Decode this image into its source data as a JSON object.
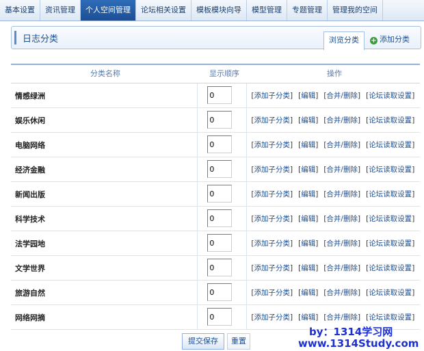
{
  "nav": {
    "tabs": [
      {
        "label": "基本设置"
      },
      {
        "label": "资讯管理"
      },
      {
        "label": "个人空间管理"
      },
      {
        "label": "论坛相关设置"
      },
      {
        "label": "模板模块向导"
      },
      {
        "label": "模型管理"
      },
      {
        "label": "专题管理"
      },
      {
        "label": "管理我的空间"
      }
    ],
    "active_index": 2
  },
  "header": {
    "title": "日志分类",
    "browse_label": "浏览分类",
    "add_label": "添加分类"
  },
  "table": {
    "columns": [
      "分类名称",
      "显示顺序",
      "操作"
    ],
    "actions": [
      "添加子分类",
      "编辑",
      "合并/删除",
      "论坛读取设置"
    ],
    "rows": [
      {
        "name": "情感绿洲",
        "order": "0"
      },
      {
        "name": "娱乐休闲",
        "order": "0"
      },
      {
        "name": "电脑网络",
        "order": "0"
      },
      {
        "name": "经济金融",
        "order": "0"
      },
      {
        "name": "新闻出版",
        "order": "0"
      },
      {
        "name": "科学技术",
        "order": "0"
      },
      {
        "name": "法学园地",
        "order": "0"
      },
      {
        "name": "文学世界",
        "order": "0"
      },
      {
        "name": "旅游自然",
        "order": "0"
      },
      {
        "name": "网络网摘",
        "order": "0"
      }
    ]
  },
  "buttons": {
    "submit_label": "提交保存",
    "reset_label": "重置"
  },
  "watermark": {
    "line1": "by：1314学习网",
    "line2": "www.1314Study.com"
  },
  "colors": {
    "active_tab": "#1b4f94",
    "link": "#1b4f94",
    "watermark": "#1c2fd1",
    "add_icon": "#3c9a3c"
  }
}
